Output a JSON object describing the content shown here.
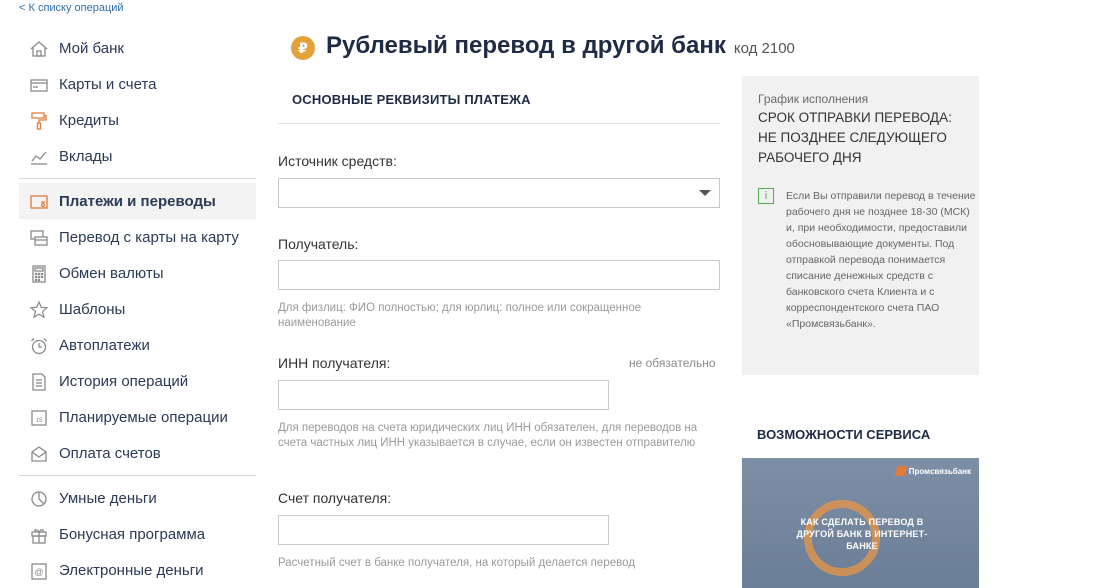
{
  "back_link": "< К списку операций",
  "sidebar": {
    "groups": [
      [
        {
          "label": "Мой банк",
          "icon": "home-icon"
        },
        {
          "label": "Карты и счета",
          "icon": "card-icon"
        },
        {
          "label": "Кредиты",
          "icon": "roller-icon"
        },
        {
          "label": "Вклады",
          "icon": "chart-icon"
        }
      ],
      [
        {
          "label": "Платежи и переводы",
          "icon": "payment-icon",
          "active": true
        },
        {
          "label": "Перевод с карты на карту",
          "icon": "cards-transfer-icon"
        },
        {
          "label": "Обмен валюты",
          "icon": "calculator-icon"
        },
        {
          "label": "Шаблоны",
          "icon": "star-icon"
        },
        {
          "label": "Автоплатежи",
          "icon": "alarm-clock-icon"
        },
        {
          "label": "История операций",
          "icon": "document-icon"
        },
        {
          "label": "Планируемые операции",
          "icon": "calendar-icon"
        },
        {
          "label": "Оплата счетов",
          "icon": "envelope-icon"
        }
      ],
      [
        {
          "label": "Умные деньги",
          "icon": "pie-chart-icon"
        },
        {
          "label": "Бонусная программа",
          "icon": "gift-icon"
        },
        {
          "label": "Электронные деньги",
          "icon": "at-icon"
        }
      ]
    ]
  },
  "header": {
    "currency_symbol": "₽",
    "title": "Рублевый перевод в другой банк",
    "code": "код 2100"
  },
  "form": {
    "section_title": "ОСНОВНЫЕ РЕКВИЗИТЫ ПЛАТЕЖА",
    "source_label": "Источник средств:",
    "source_value": "",
    "recipient_label": "Получатель:",
    "recipient_value": "",
    "recipient_hint": "Для физлиц: ФИО полностью; для юрлиц: полное или сокращенное наименование",
    "inn_label": "ИНН получателя:",
    "inn_optional": "не обязательно",
    "inn_value": "",
    "inn_hint": "Для переводов на счета юридических лиц ИНН обязателен, для переводов на счета частных лиц ИНН указывается в случае, если он известен отправителю",
    "account_label": "Счет получателя:",
    "account_value": "",
    "account_hint": "Расчетный счет в банке получателя, на который делается перевод"
  },
  "info_panel": {
    "caption": "График исполнения",
    "heading": "СРОК ОТПРАВКИ ПЕРЕВОДА: НЕ ПОЗДНЕЕ СЛЕДУЮЩЕГО РАБОЧЕГО ДНЯ",
    "icon_glyph": "i",
    "text": "Если Вы отправили перевод в течение рабочего дня не позднее 18-30 (МСК) и, при необходимости, предоставили обосновывающие документы. Под отправкой перевода понимается списание денежных средств с банковского счета Клиента и с корреспондентского счета ПАО «Промсвязьбанк»."
  },
  "service": {
    "title": "ВОЗМОЖНОСТИ СЕРВИСА",
    "video_brand": "Промсвязьбанк",
    "video_caption": "КАК СДЕЛАТЬ ПЕРЕВОД В ДРУГОЙ БАНК В ИНТЕРНЕТ-БАНКЕ"
  },
  "colors": {
    "accent": "#e07b3c",
    "title": "#1e2b45",
    "link": "#2f6fa8",
    "panel_bg": "#f1f1f1"
  }
}
